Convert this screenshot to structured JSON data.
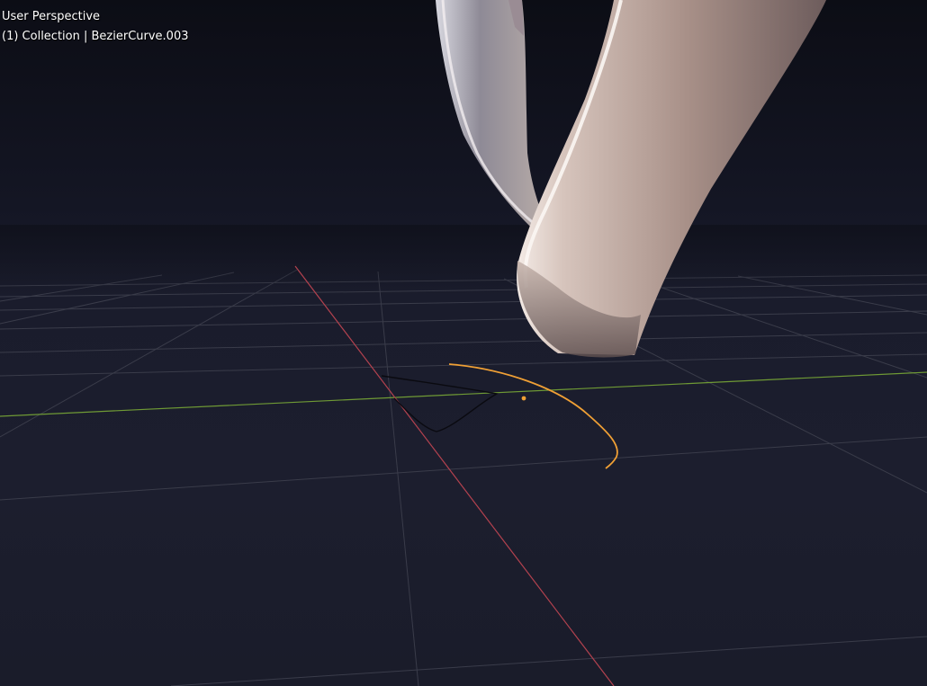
{
  "viewport": {
    "view_label": "User Perspective",
    "collection_label": "(1) Collection | BezierCurve.003"
  },
  "colors": {
    "background": "#1a1c2a",
    "grid_line": "#3a3c4a",
    "x_axis": "#b3424f",
    "y_axis": "#6f9a35",
    "selected_curve": "#f0a035",
    "unselected_curve": "#0a0a10",
    "mesh_highlight": "#e9dcd6",
    "mesh_shadow": "#5a4c4c"
  },
  "objects": {
    "mesh": "curved tube object (metallic shaded)",
    "selected": "BezierCurve.003",
    "other": "bezier curve (unselected)"
  }
}
